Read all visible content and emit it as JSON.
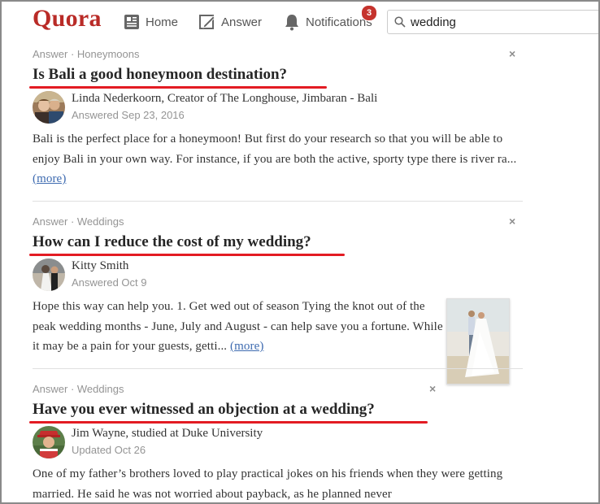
{
  "header": {
    "logo": "Quora",
    "nav": {
      "home": "Home",
      "answer": "Answer",
      "notifications": "Notifications",
      "notifications_count": "3"
    },
    "search": {
      "value": "wedding",
      "placeholder": ""
    }
  },
  "stories": [
    {
      "meta": "Answer · Honeymoons",
      "question": "Is Bali a good honeymoon destination?",
      "author": "Linda Nederkoorn, Creator of The Longhouse, Jimbaran - Bali",
      "date": "Answered Sep 23, 2016",
      "text": "Bali is the perfect place for a honeymoon! But first do your research so that you will be able to enjoy Bali in your own way. For instance, if you are both the active, sporty type there is river ra...",
      "more": "(more)"
    },
    {
      "meta": "Answer · Weddings",
      "question": "How can I reduce the cost of my wedding?",
      "author": "Kitty Smith",
      "date": "Answered Oct 9",
      "text": "Hope this way can help you. 1. Get wed out of season Tying the knot out of the peak wedding months - June, July and August - can help save you a fortune. While it may be a pain for your guests, getti...",
      "more": "(more)"
    },
    {
      "meta": "Answer · Weddings",
      "question": "Have you ever witnessed an objection at a wedding?",
      "author": "Jim Wayne, studied at Duke University",
      "date": "Updated Oct 26",
      "text": "One of my father’s brothers loved to play practical jokes on his friends when they were getting married. He said he was not worried about payback, as he planned never"
    }
  ],
  "close_glyph": "×",
  "colors": {
    "brand": "#b92b27",
    "underline": "#e31b23",
    "link": "#3e6bb0",
    "badge": "#c5332d"
  }
}
